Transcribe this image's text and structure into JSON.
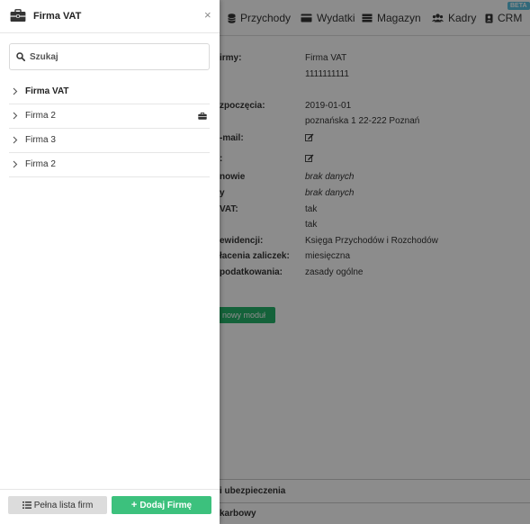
{
  "drawer": {
    "title": "Firma VAT",
    "close_glyph": "×",
    "search": {
      "placeholder": "Szukaj"
    },
    "companies": [
      {
        "name": "Firma VAT",
        "active": true,
        "icon": "chevron-right-icon"
      },
      {
        "name": "Firma 2",
        "active": false,
        "icon": "chevron-right-icon",
        "badge_icon": "briefcase-icon"
      },
      {
        "name": "Firma 3",
        "active": false,
        "icon": "chevron-right-icon"
      },
      {
        "name": "Firma 2",
        "active": false,
        "icon": "chevron-right-icon"
      }
    ],
    "footer": {
      "full_list_label": "Pełna lista firm",
      "add_company_label": "Dodaj Firmę"
    }
  },
  "topnav": {
    "items": [
      {
        "label": "Przychody",
        "icon": "database-icon"
      },
      {
        "label": "Wydatki",
        "icon": "credit-card-icon"
      },
      {
        "label": "Magazyn",
        "icon": "warehouse-icon"
      },
      {
        "label": "Kadry",
        "icon": "users-icon"
      },
      {
        "label": "CRM",
        "icon": "contact-icon"
      }
    ],
    "beta_badge": "BETA"
  },
  "details": {
    "rows": [
      {
        "key": "irmy:",
        "value": "Firma VAT",
        "italic": false
      },
      {
        "key": "",
        "value": "1111111111",
        "italic": false
      },
      {
        "key": "zpoczęcia:",
        "value": "2019-01-01",
        "italic": false
      },
      {
        "key": "",
        "value": "poznańska 1 22-222 Poznań",
        "italic": false
      },
      {
        "key": "-mail:",
        "value": "",
        "italic": false,
        "edit": true
      },
      {
        "key": ":",
        "value": "",
        "italic": false,
        "edit": true
      },
      {
        "key": "nowie",
        "value": "brak danych",
        "italic": true
      },
      {
        "key": "y",
        "value": "brak danych",
        "italic": true
      },
      {
        "key": "VAT:",
        "value": "tak",
        "italic": false
      },
      {
        "key": "",
        "value": "tak",
        "italic": false
      },
      {
        "key": "ewidencji:",
        "value": "Księga Przychodów i Rozchodów",
        "italic": false
      },
      {
        "key": "łacenia zaliczek:",
        "value": "miesięczna",
        "italic": false
      },
      {
        "key": "podatkowania:",
        "value": "zasady ogólne",
        "italic": false
      }
    ],
    "new_module_label": "nowy moduł"
  },
  "sections": {
    "section1": "i ubezpieczenia",
    "section2": "karbowy"
  },
  "colors": {
    "primary_green": "#3cc17d",
    "button_grey": "#dcdcdc",
    "overlay": "rgba(0,0,0,0.45)",
    "beta_blue": "#5bc0de"
  }
}
